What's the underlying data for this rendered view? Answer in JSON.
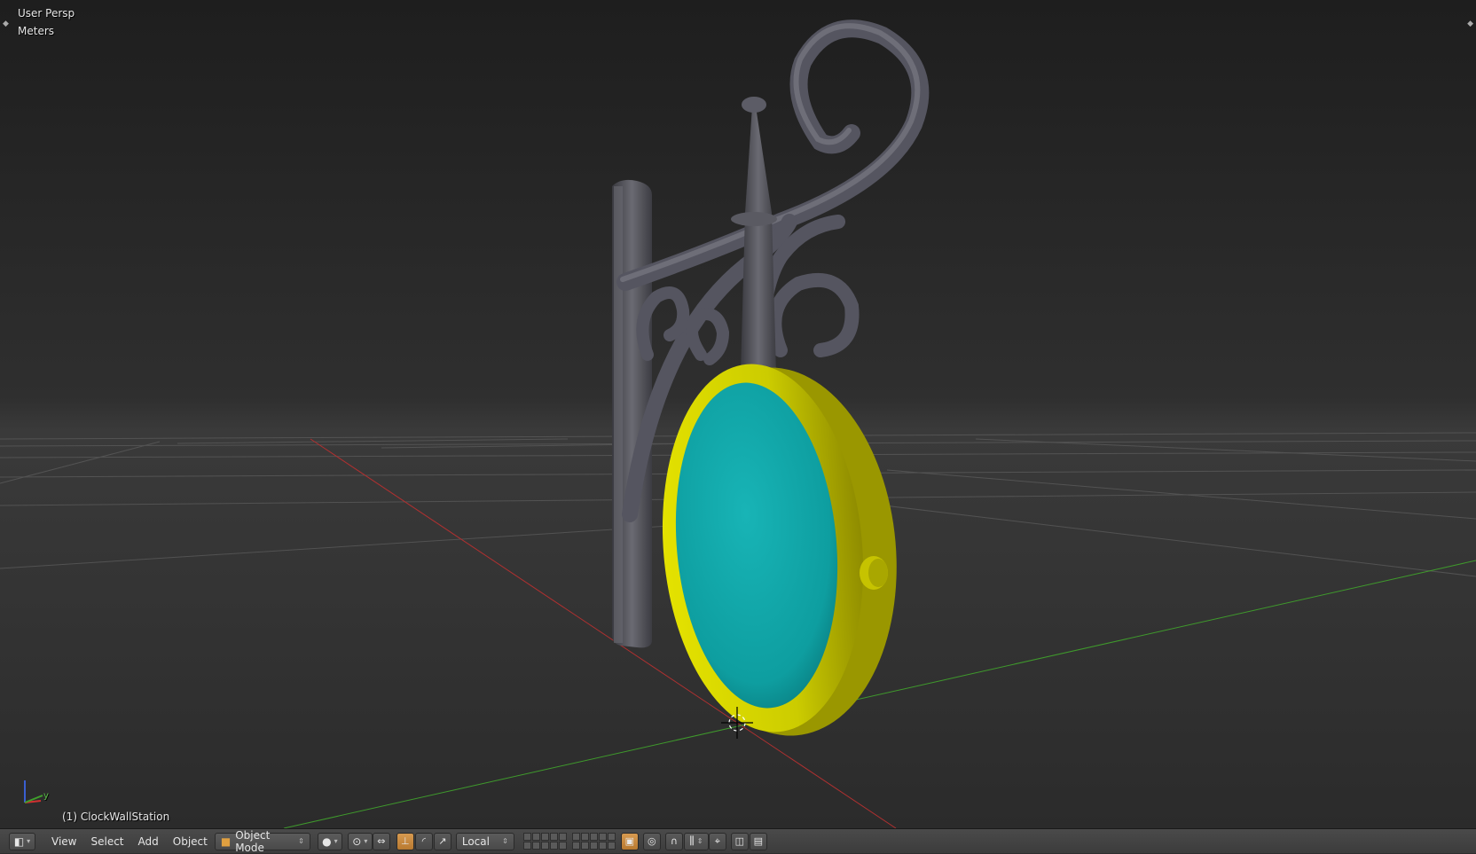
{
  "viewport": {
    "view_name": "User Persp",
    "units": "Meters",
    "object_label": "(1) ClockWallStation",
    "axis_y_label": "y",
    "colors": {
      "clock_face": "#12a6a8",
      "clock_frame": "#d2d000",
      "iron": "#4b4b52",
      "x_axis": "#b03030",
      "y_axis": "#3f9a2c"
    }
  },
  "header": {
    "editor_type_icon": "3d-view-icon",
    "menus": [
      "View",
      "Select",
      "Add",
      "Object"
    ],
    "mode": "Object Mode",
    "pivot_icon": "pivot-point-icon",
    "orientation": "Local"
  }
}
